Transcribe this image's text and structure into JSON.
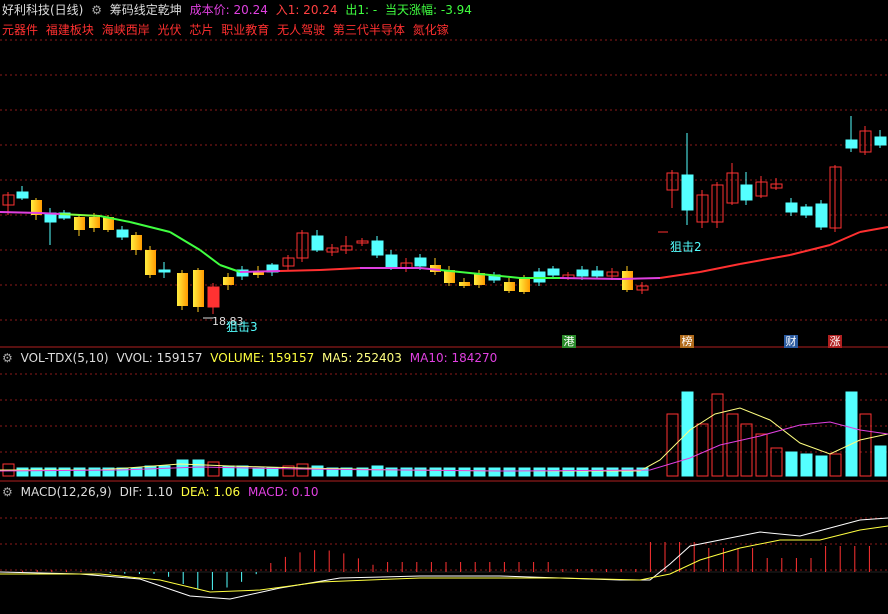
{
  "header": {
    "stock_name": "好利科技(日线)",
    "indicator_name": "筹码线定乾坤",
    "cost_label": "成本价: 20.24",
    "in_label": "入1: 20.24",
    "out_label": "出1: -",
    "change_label": "当天涨幅: -3.94",
    "concepts": [
      "元器件",
      "福建板块",
      "海峡西岸",
      "光伏",
      "芯片",
      "职业教育",
      "无人驾驶",
      "第三代半导体",
      "氮化镓"
    ]
  },
  "main_panel": {
    "annotations": [
      "狙击3",
      "18.83",
      "狙击2"
    ],
    "badges": [
      {
        "text": "港",
        "color": "#2a8a2a"
      },
      {
        "text": "榜",
        "color": "#b06a1a"
      },
      {
        "text": "财",
        "color": "#2a5aa0"
      },
      {
        "text": "涨",
        "color": "#b02020"
      }
    ]
  },
  "vol_panel": {
    "title": "VOL-TDX(5,10)",
    "vvol": "VVOL: 159157",
    "volume": "VOLUME: 159157",
    "ma5": "MA5: 252403",
    "ma10": "MA10: 184270"
  },
  "macd_panel": {
    "title": "MACD(12,26,9)",
    "dif": "DIF: 1.10",
    "dea": "DEA: 1.06",
    "macd": "MACD: 0.10"
  },
  "colors": {
    "up": "#ff3232",
    "down": "#54ffff",
    "ma5": "#ffff80",
    "ma10": "#e040e0",
    "grid": "#8b1a1a"
  },
  "chart_data": {
    "type": "candlestick",
    "volume_ma5_last": 252403,
    "volume_ma10_last": 184270,
    "volume_last": 159157,
    "dif_last": 1.1,
    "dea_last": 1.06,
    "macd_last": 0.1
  }
}
